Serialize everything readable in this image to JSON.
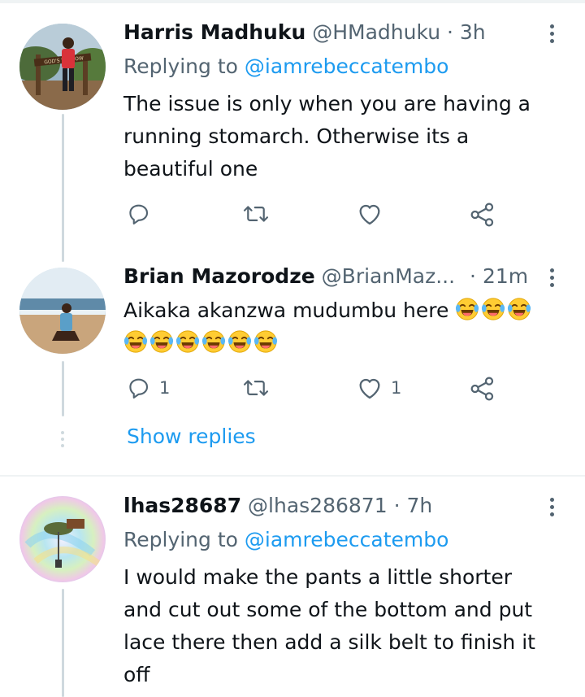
{
  "colors": {
    "accent": "#1d9bf0",
    "muted": "#536471",
    "text": "#0f1419",
    "line": "#cfd9de"
  },
  "tweets": [
    {
      "name": "Harris Madhuku",
      "handle": "@HMadhuku",
      "sep": "·",
      "time": "3h",
      "replying_prefix": "Replying to",
      "replying_to": "@iamrebeccatembo",
      "body_lines": [
        "The issue is only when you are having a",
        "running stomarch. Otherwise its a",
        "beautiful one"
      ],
      "sign_text": "GOD'S WINDOW",
      "reply_count": "",
      "retweet_count": "",
      "like_count": ""
    },
    {
      "name": "Brian Mazorodze",
      "handle": "@BrianMaz...",
      "sep": "·",
      "time": "21m",
      "body_text": "Aikaka akanzwa mudumbu here",
      "emoji_line1_count": 3,
      "emoji_line2_count": 6,
      "emoji_icon": "face-with-tears-of-joy-icon",
      "reply_count": "1",
      "retweet_count": "",
      "like_count": "1",
      "show_replies": "Show replies"
    },
    {
      "name": "lhas28687",
      "handle": "@lhas286871",
      "sep": "·",
      "time": "7h",
      "replying_prefix": "Replying to",
      "replying_to": "@iamrebeccatembo",
      "body_lines": [
        "I would make the pants a little shorter",
        "and cut out some of the bottom and put",
        "lace there then add a silk belt to finish it",
        "off"
      ]
    }
  ]
}
